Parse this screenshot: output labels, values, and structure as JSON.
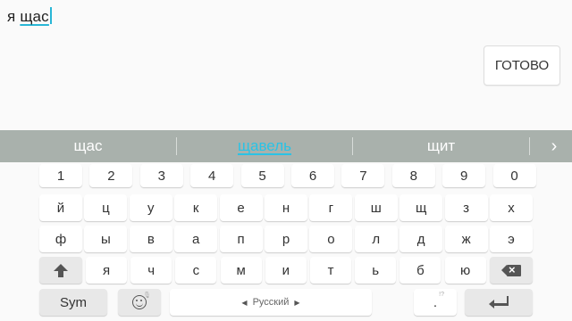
{
  "input": {
    "prefix": "я ",
    "word": "щас"
  },
  "done_button": {
    "label": "ГОТОВО"
  },
  "suggestions": [
    "щас",
    "щавель",
    "щит"
  ],
  "keyboard": {
    "numbers": [
      "1",
      "2",
      "3",
      "4",
      "5",
      "6",
      "7",
      "8",
      "9",
      "0"
    ],
    "row1": [
      "й",
      "ц",
      "у",
      "к",
      "е",
      "н",
      "г",
      "ш",
      "щ",
      "з",
      "х"
    ],
    "row2": [
      "ф",
      "ы",
      "в",
      "а",
      "п",
      "р",
      "о",
      "л",
      "д",
      "ж",
      "э"
    ],
    "row3": [
      "я",
      "ч",
      "с",
      "м",
      "и",
      "т",
      "ь",
      "б",
      "ю"
    ],
    "sym_label": "Sym",
    "language_label": "Русский",
    "period_hint": "!?",
    "period_char": "."
  },
  "icons": {
    "shift": "shift-icon",
    "backspace": "backspace-icon",
    "emoji": "emoji-icon",
    "enter": "enter-icon",
    "suggestions_more": "chevron-right-icon"
  },
  "colors": {
    "accent": "#29c3e6",
    "suggestion_bar": "#a9b1ac",
    "keyboard_bg": "#fafafa",
    "key_bg": "#ffffff"
  }
}
